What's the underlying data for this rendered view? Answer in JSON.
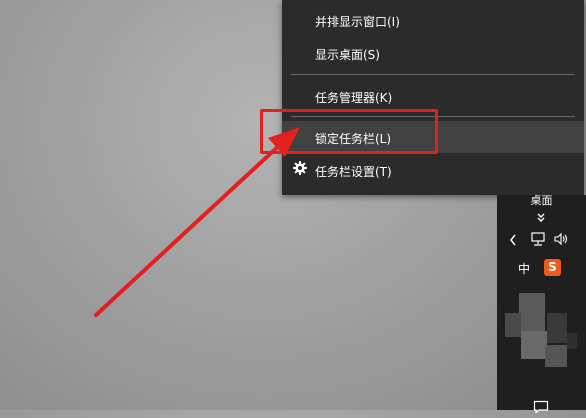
{
  "context_menu": {
    "items": [
      {
        "label": "并排显示窗口(I)"
      },
      {
        "label": "显示桌面(S)"
      },
      {
        "label": "任务管理器(K)"
      },
      {
        "label": "锁定任务栏(L)"
      },
      {
        "label": "任务栏设置(T)"
      }
    ]
  },
  "taskbar": {
    "desktop_label": "桌面",
    "ime_label": "中",
    "sogou_label": "S"
  },
  "colors": {
    "menu_bg": "#2b2b2b",
    "menu_highlight": "#414141",
    "annotation_red": "#e32020",
    "sogou_orange": "#f05a1a"
  },
  "icons": [
    "gear-icon",
    "double-chevron-down-icon",
    "chevron-left-icon",
    "network-icon",
    "volume-icon",
    "sogou-ime-icon",
    "action-center-icon"
  ]
}
